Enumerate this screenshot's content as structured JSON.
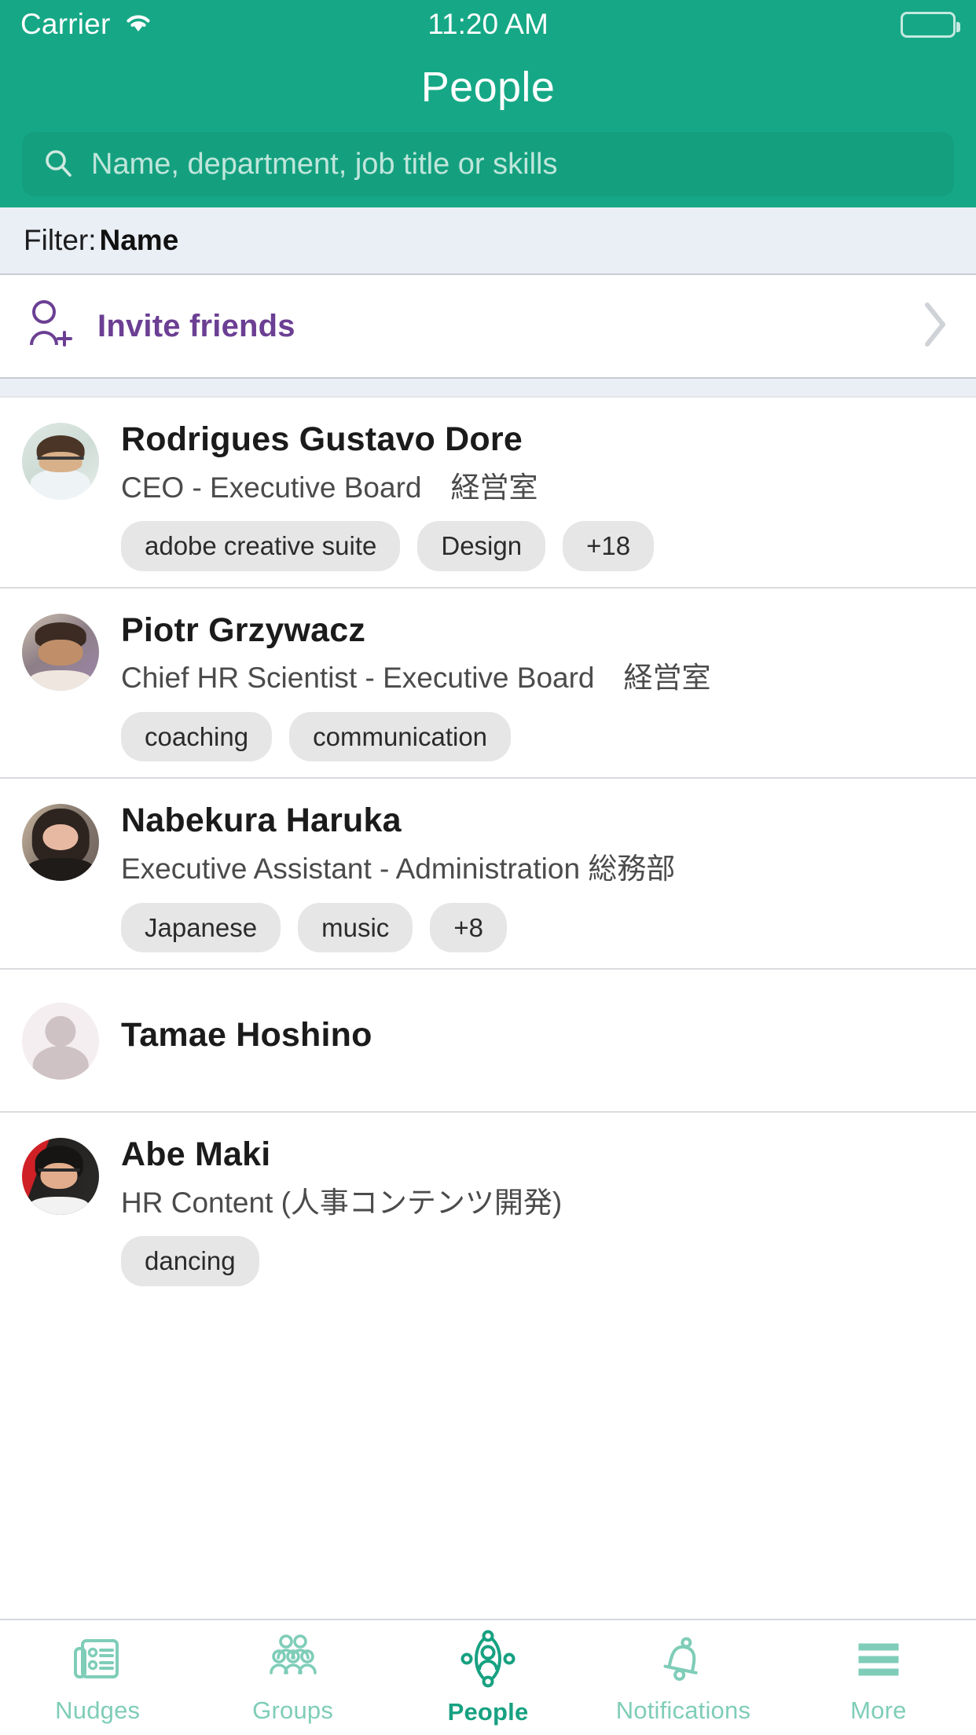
{
  "status_bar": {
    "carrier": "Carrier",
    "time": "11:20 AM",
    "wifi_icon": "wifi-icon",
    "battery_icon": "battery-icon"
  },
  "header": {
    "title": "People",
    "background_color": "#16a886",
    "search": {
      "icon": "search-icon",
      "placeholder": "Name, department, job title or skills",
      "value": ""
    }
  },
  "filter": {
    "label": "Filter:",
    "value": "Name"
  },
  "invite": {
    "icon": "person-add-icon",
    "label": "Invite friends",
    "chevron_icon": "chevron-right-icon",
    "accent_color": "#6b3f93"
  },
  "people": [
    {
      "name": "Rodrigues Gustavo Dore",
      "title": "CEO - Executive Board　経営室",
      "avatar": "avatar-rodrigues",
      "tags": [
        "adobe creative suite",
        "Design",
        "+18"
      ]
    },
    {
      "name": "Piotr Grzywacz",
      "title": "Chief HR Scientist - Executive Board　経営室",
      "avatar": "avatar-piotr",
      "tags": [
        "coaching",
        "communication"
      ]
    },
    {
      "name": "Nabekura Haruka",
      "title": "Executive Assistant - Administration 総務部",
      "avatar": "avatar-nabekura",
      "tags": [
        "Japanese",
        "music",
        "+8"
      ]
    },
    {
      "name": "Tamae Hoshino",
      "title": "",
      "avatar": "avatar-placeholder",
      "tags": []
    },
    {
      "name": "Abe Maki",
      "title": "HR Content (人事コンテンツ開発)",
      "avatar": "avatar-abe",
      "tags": [
        "dancing"
      ]
    }
  ],
  "tabbar": {
    "active_color": "#17a181",
    "inactive_color": "#7fcdb8",
    "tabs": [
      {
        "label": "Nudges",
        "icon": "nudges-document-icon",
        "active": false
      },
      {
        "label": "Groups",
        "icon": "groups-people-icon",
        "active": false
      },
      {
        "label": "People",
        "icon": "people-network-icon",
        "active": true
      },
      {
        "label": "Notifications",
        "icon": "bell-icon",
        "active": false
      },
      {
        "label": "More",
        "icon": "hamburger-menu-icon",
        "active": false
      }
    ]
  }
}
